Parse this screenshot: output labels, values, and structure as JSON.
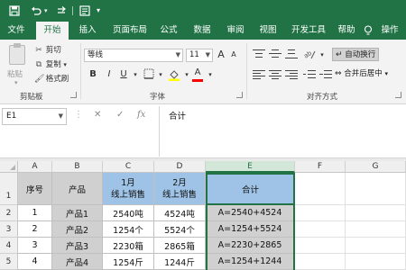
{
  "titlebar": {
    "icons": [
      "save-icon",
      "undo-icon",
      "dropdown-icon",
      "form-icon",
      "customize-icon"
    ],
    "colors": {
      "bg": "#217346"
    }
  },
  "tabs": [
    "文件",
    "开始",
    "插入",
    "页面布局",
    "公式",
    "数据",
    "审阅",
    "视图",
    "开发工具",
    "帮助",
    "操作"
  ],
  "active_tab": "开始",
  "clipboard": {
    "paste_label": "粘贴",
    "cut_label": "剪切",
    "copy_label": "复制",
    "format_painter_label": "格式刷",
    "group_label": "剪贴板"
  },
  "font": {
    "font_name": "等线",
    "font_size": "11",
    "grow_label": "A",
    "shrink_label": "A",
    "bold": "B",
    "italic": "I",
    "underline": "U",
    "text_color_label": "A",
    "fill_color": "#ffff00",
    "font_color": "#ff0000",
    "group_label": "字体"
  },
  "alignment": {
    "wrap_label": "自动换行",
    "merge_label": "合并后居中",
    "group_label": "对齐方式"
  },
  "formula_bar": {
    "name_box": "E1",
    "content": "合计"
  },
  "grid": {
    "columns": [
      "A",
      "B",
      "C",
      "D",
      "E",
      "F",
      "G"
    ],
    "selected_column": "E",
    "rows": [
      {
        "num": "1",
        "cells": [
          "序号",
          "产品",
          [
            "1月",
            "线上销售"
          ],
          [
            "2月",
            "线上销售"
          ],
          "合计",
          "",
          ""
        ]
      },
      {
        "num": "2",
        "cells": [
          "1",
          "产品1",
          "2540吨",
          "4524吨",
          "A=2540+4524",
          "",
          ""
        ]
      },
      {
        "num": "3",
        "cells": [
          "2",
          "产品2",
          "1254个",
          "5524个",
          "A=1254+5524",
          "",
          ""
        ]
      },
      {
        "num": "4",
        "cells": [
          "3",
          "产品3",
          "2230箱",
          "2865箱",
          "A=2230+2865",
          "",
          ""
        ]
      },
      {
        "num": "5",
        "cells": [
          "4",
          "产品4",
          "1254斤",
          "1244斤",
          "A=1254+1244",
          "",
          ""
        ]
      }
    ],
    "colors": {
      "gray": "#d0d0d0",
      "blue": "#9ec3e6",
      "accent": "#217346"
    }
  }
}
